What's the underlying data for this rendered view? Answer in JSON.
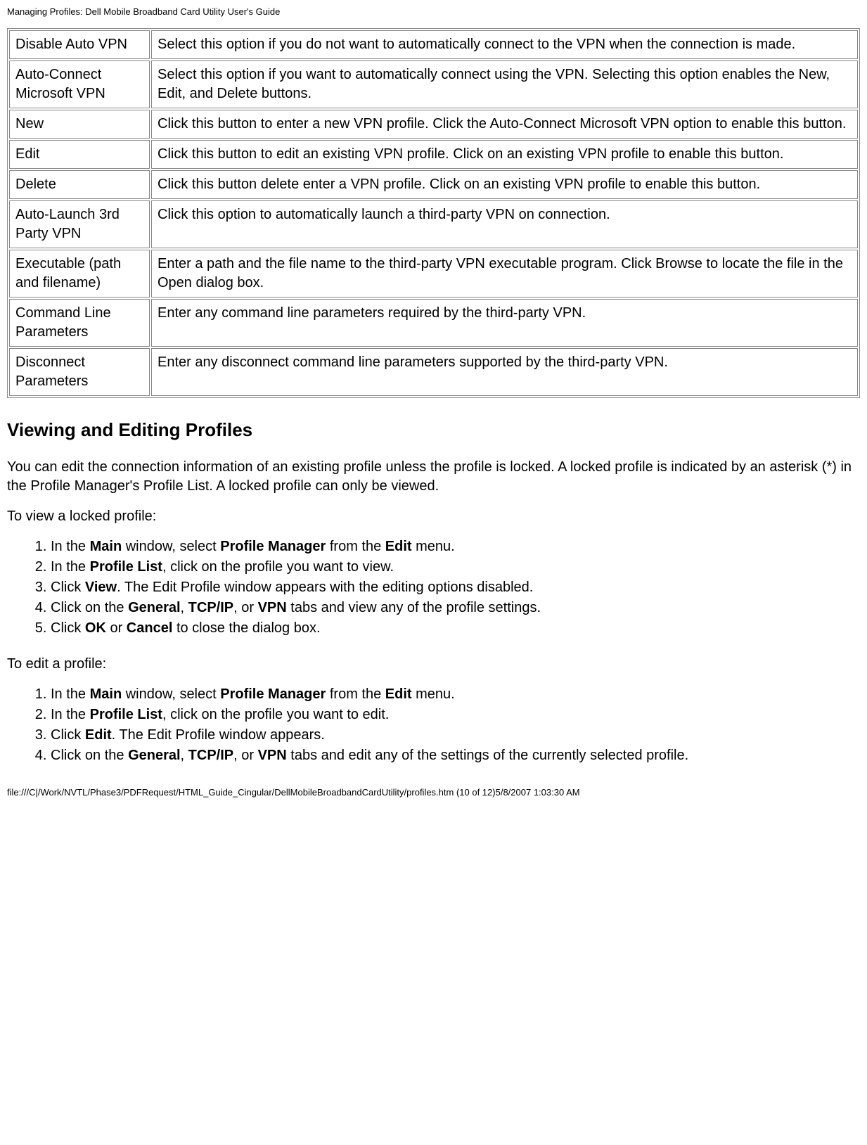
{
  "header_text": "Managing Profiles: Dell Mobile Broadband Card Utility User's Guide",
  "table_rows": [
    {
      "label": "Disable Auto VPN",
      "desc": "Select this option if you do not want to automatically connect to the VPN when the connection is made."
    },
    {
      "label": "Auto-Connect Microsoft VPN",
      "desc": "Select this option if you want to automatically connect using the VPN. Selecting this option enables the New, Edit, and Delete buttons."
    },
    {
      "label": "New",
      "desc": "Click this button to enter a new VPN profile. Click the Auto-Connect Microsoft VPN option to enable this button."
    },
    {
      "label": "Edit",
      "desc": "Click this button to edit an existing VPN profile. Click on an existing VPN profile to enable this button."
    },
    {
      "label": "Delete",
      "desc": "Click this button delete enter a VPN profile. Click on an existing VPN profile to enable this button."
    },
    {
      "label": "Auto-Launch 3rd Party VPN",
      "desc": "Click this option to automatically launch a third-party VPN on connection."
    },
    {
      "label": "Executable (path and filename)",
      "desc": "Enter a path and the file name to the third-party VPN executable program. Click Browse to locate the file in the Open dialog box."
    },
    {
      "label": "Command Line Parameters",
      "desc": "Enter any command line parameters required by the third-party VPN."
    },
    {
      "label": "Disconnect Parameters",
      "desc": "Enter any disconnect command line parameters supported by the third-party VPN."
    }
  ],
  "heading_viewedit": "Viewing and Editing Profiles",
  "intro_para": "You can edit the connection information of an existing profile unless the profile is locked. A locked profile is indicated by an asterisk (*) in the Profile Manager's Profile List. A locked profile can only be viewed.",
  "view_intro": "To view a locked profile:",
  "edit_intro": "To edit a profile:",
  "footer_text": "file:///C|/Work/NVTL/Phase3/PDFRequest/HTML_Guide_Cingular/DellMobileBroadbandCardUtility/profiles.htm (10 of 12)5/8/2007 1:03:30 AM"
}
